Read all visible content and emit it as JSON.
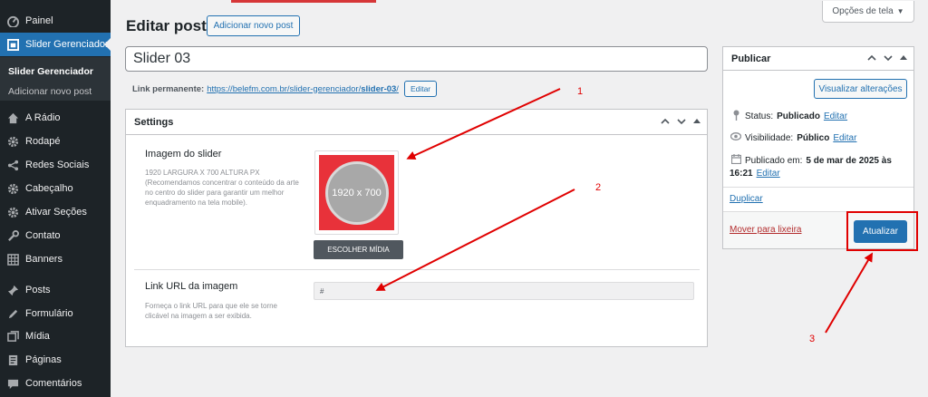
{
  "sidebar": {
    "items": [
      {
        "label": "Painel",
        "icon": "dashboard-icon"
      },
      {
        "label": "Slider Gerenciador",
        "icon": "slider-icon"
      },
      {
        "label": "A Rádio",
        "icon": "home-icon"
      },
      {
        "label": "Rodapé",
        "icon": "gear-icon"
      },
      {
        "label": "Redes Sociais",
        "icon": "share-icon"
      },
      {
        "label": "Cabeçalho",
        "icon": "gear-icon"
      },
      {
        "label": "Ativar Seções",
        "icon": "gear-icon"
      },
      {
        "label": "Contato",
        "icon": "wrench-icon"
      },
      {
        "label": "Banners",
        "icon": "table-icon"
      },
      {
        "label": "Posts",
        "icon": "pin-icon"
      },
      {
        "label": "Formulário",
        "icon": "pencil-icon"
      },
      {
        "label": "Mídia",
        "icon": "media-icon"
      },
      {
        "label": "Páginas",
        "icon": "page-icon"
      },
      {
        "label": "Comentários",
        "icon": "comment-icon"
      }
    ],
    "submenu": {
      "current": "Slider Gerenciador",
      "add_new": "Adicionar novo post"
    }
  },
  "header": {
    "title": "Editar post",
    "add_new_button": "Adicionar novo post",
    "screen_options": "Opções de tela"
  },
  "post": {
    "title_value": "Slider 03",
    "permalink_label": "Link permanente:",
    "permalink_base": "https://belefm.com.br/slider-gerenciador/",
    "permalink_slug": "slider-03",
    "permalink_trailing": "/",
    "permalink_edit": "Editar"
  },
  "settings": {
    "title": "Settings",
    "image_label": "Imagem do slider",
    "image_desc": "1920 LARGURA X 700 ALTURA PX (Recomendamos concentrar o conteúdo da arte no centro do slider para garantir um melhor enquadramento na tela mobile).",
    "thumb_text": "1920 x 700",
    "media_button": "ESCOLHER MÍDIA",
    "url_label": "Link URL da imagem",
    "url_desc": "Forneça o link URL para que ele se torne clicável na imagem a ser exibida.",
    "url_value": "#"
  },
  "publish": {
    "title": "Publicar",
    "preview_button": "Visualizar alterações",
    "status_label": "Status:",
    "status_value": "Publicado",
    "visibility_label": "Visibilidade:",
    "visibility_value": "Público",
    "published_label": "Publicado em:",
    "published_value": "5 de mar de 2025 às",
    "published_time": "16:21",
    "edit_link": "Editar",
    "duplicate": "Duplicar",
    "trash": "Mover para lixeira",
    "update_button": "Atualizar"
  },
  "annotations": [
    "1",
    "2",
    "3"
  ],
  "colors": {
    "sidebar_bg": "#1d2327",
    "accent": "#2271b1",
    "annotation": "#e00000",
    "thumb_bg": "#e8323a"
  }
}
